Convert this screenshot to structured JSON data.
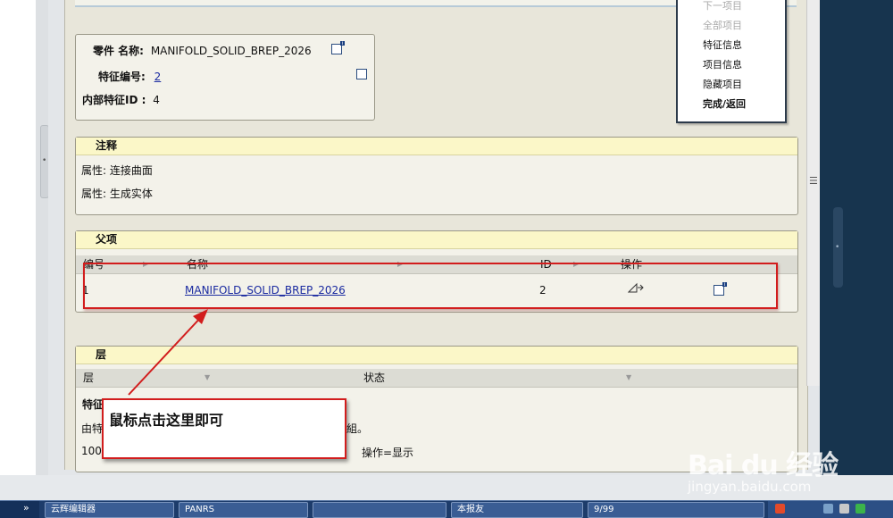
{
  "menu": {
    "items": [
      {
        "label": "下一项目",
        "state": "disabled"
      },
      {
        "label": "全部项目",
        "state": "disabled"
      },
      {
        "label": "特征信息",
        "state": "normal"
      },
      {
        "label": "项目信息",
        "state": "normal"
      },
      {
        "label": "隐藏项目",
        "state": "normal"
      },
      {
        "label": "完成/返回",
        "state": "bold"
      }
    ]
  },
  "part_info": {
    "name_label": "零件 名称:",
    "name_value": "MANIFOLD_SOLID_BREP_2026",
    "feature_label": "特征编号:",
    "feature_value": "2",
    "internal_label": "内部特征ID :",
    "internal_value": "4"
  },
  "notes": {
    "title": "注释",
    "lines": [
      "属性: 连接曲面",
      "属性: 生成实体"
    ]
  },
  "parents": {
    "title": "父项",
    "headers": [
      "编号",
      "名称",
      "ID",
      "操作"
    ],
    "rows": [
      {
        "num": "1",
        "name": "MANIFOLD_SOLID_BREP_2026",
        "id": "2"
      }
    ]
  },
  "layers": {
    "title": "层",
    "headers": [
      "层",
      "状态"
    ],
    "subtitle": "特征",
    "desc_prefix": "由特",
    "desc_suffix": "組。",
    "row_num": "100",
    "row_status": "操作=显示"
  },
  "callout": {
    "text": "鼠标点击这里即可"
  },
  "watermark": {
    "main": "Bai du 经验",
    "sub": "jingyan.baidu.com"
  },
  "taskbar": {
    "start": "»",
    "buttons": [
      "云辉编辑器",
      "PANRS",
      "",
      "本报友",
      "9/99"
    ]
  },
  "colors": {
    "annotation": "#d21d1d",
    "header": "#fbf7c8",
    "link": "#1a2aa0"
  }
}
